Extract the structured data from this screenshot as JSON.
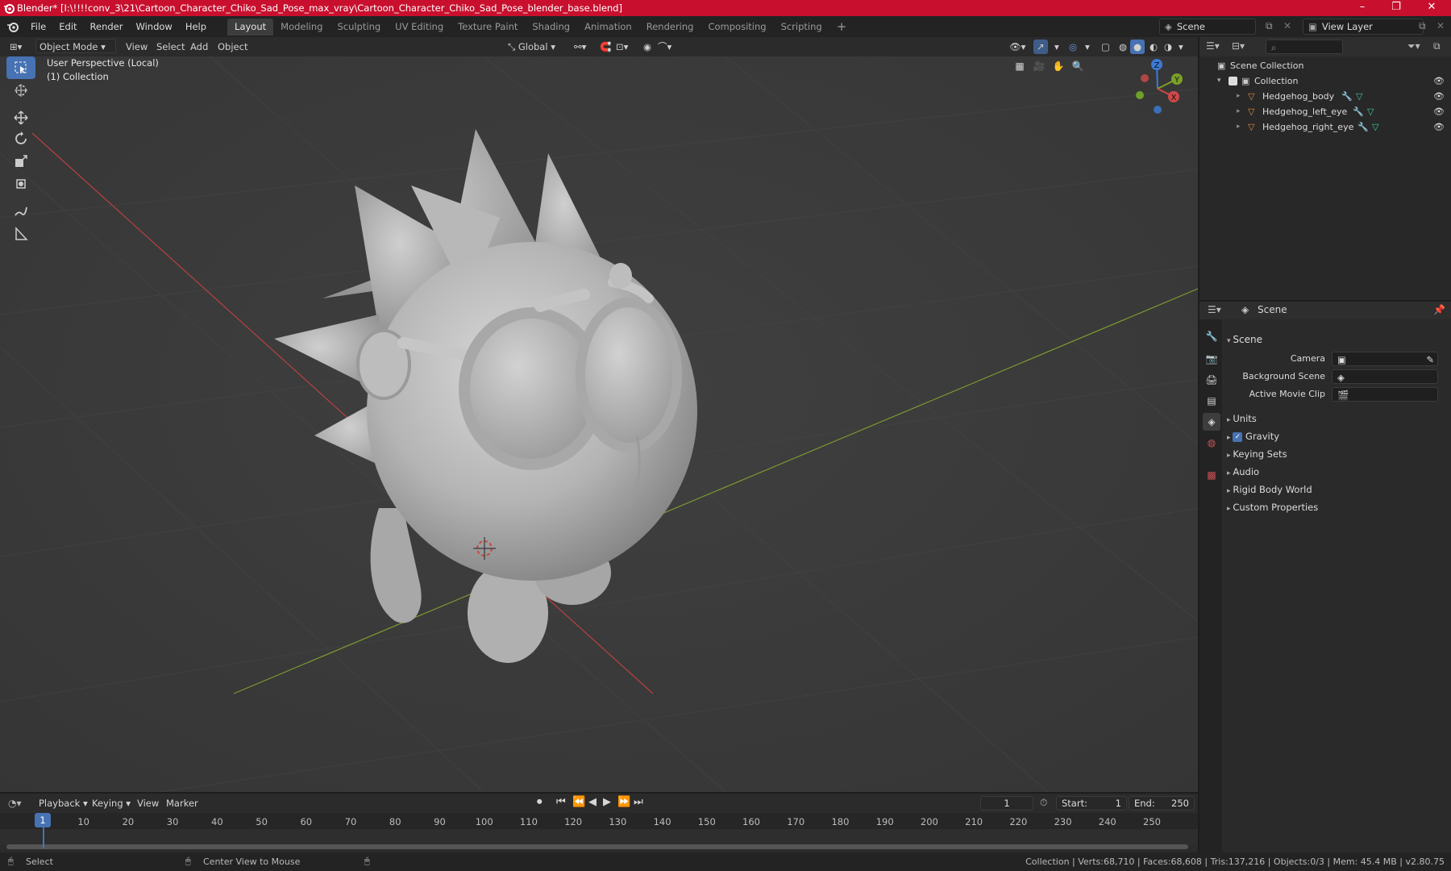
{
  "window": {
    "title": "Blender* [I:\\!!!!conv_3\\21\\Cartoon_Character_Chiko_Sad_Pose_max_vray\\Cartoon_Character_Chiko_Sad_Pose_blender_base.blend]"
  },
  "menu": [
    "File",
    "Edit",
    "Render",
    "Window",
    "Help"
  ],
  "workspaces": [
    "Layout",
    "Modeling",
    "Sculpting",
    "UV Editing",
    "Texture Paint",
    "Shading",
    "Animation",
    "Rendering",
    "Compositing",
    "Scripting"
  ],
  "scene_field": "Scene",
  "view_layer_field": "View Layer",
  "header": {
    "mode": "Object Mode",
    "view": "View",
    "select": "Select",
    "add": "Add",
    "object": "Object",
    "orientation": "Global"
  },
  "viewport": {
    "info_line1": "User Perspective (Local)",
    "info_line2": "(1) Collection"
  },
  "gizmo": {
    "z": "Z",
    "y": "Y",
    "x": "X"
  },
  "outliner": {
    "root": "Scene Collection",
    "collection": "Collection",
    "objects": [
      "Hedgehog_body",
      "Hedgehog_left_eye",
      "Hedgehog_right_eye"
    ]
  },
  "properties": {
    "context": "Scene",
    "panel_title": "Scene",
    "camera_label": "Camera",
    "bg_scene_label": "Background Scene",
    "movie_clip_label": "Active Movie Clip",
    "sections": [
      "Units",
      "Gravity",
      "Keying Sets",
      "Audio",
      "Rigid Body World",
      "Custom Properties"
    ],
    "gravity_checked": true
  },
  "timeline": {
    "playback": "Playback",
    "keying": "Keying",
    "view": "View",
    "marker": "Marker",
    "current_frame": "1",
    "start_label": "Start:",
    "start": "1",
    "end_label": "End:",
    "end": "250",
    "ticks": [
      "10",
      "20",
      "30",
      "40",
      "50",
      "60",
      "70",
      "80",
      "90",
      "100",
      "110",
      "120",
      "130",
      "140",
      "150",
      "160",
      "170",
      "180",
      "190",
      "200",
      "210",
      "220",
      "230",
      "240",
      "250"
    ],
    "playhead": "1"
  },
  "status": {
    "left": "Select",
    "middle": "Center View to Mouse",
    "right": "Collection | Verts:68,710 | Faces:68,608 | Tris:137,216 | Objects:0/3 | Mem: 45.4 MB | v2.80.75"
  },
  "colors": {
    "title_bar": "#c8102e",
    "accent": "#4772b3",
    "axis_x": "#c04040",
    "axis_y": "#7a9a30"
  }
}
